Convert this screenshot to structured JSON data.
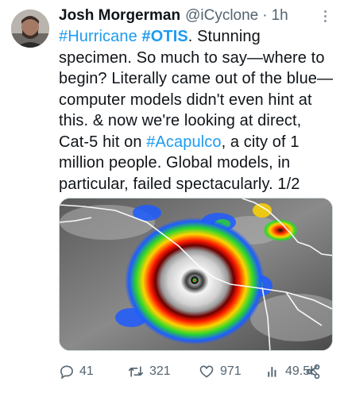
{
  "tweet": {
    "author_name": "Josh Morgerman",
    "handle": "@iCyclone",
    "separator": "·",
    "time": "1h",
    "text_lines": [
      [
        {
          "t": "#Hurricane",
          "c": "link"
        },
        {
          "t": " ",
          "c": "plain"
        },
        {
          "t": "#OTIS",
          "c": "link bold"
        },
        {
          "t": ". Stunning",
          "c": "plain"
        }
      ],
      [
        {
          "t": "specimen. So much to say—where to",
          "c": "plain"
        }
      ],
      [
        {
          "t": "begin? Literally came out of the blue—",
          "c": "plain"
        }
      ],
      [
        {
          "t": "computer models didn't even hint at",
          "c": "plain"
        }
      ],
      [
        {
          "t": "this. & now we're looking at direct,",
          "c": "plain"
        }
      ],
      [
        {
          "t": "Cat-5 hit on ",
          "c": "plain"
        },
        {
          "t": "#Acapulco",
          "c": "link"
        },
        {
          "t": ", a city of 1",
          "c": "plain"
        }
      ],
      [
        {
          "t": "million people. Global models, in",
          "c": "plain"
        }
      ],
      [
        {
          "t": "particular, failed spectacularly. 1/2",
          "c": "plain"
        }
      ]
    ],
    "media_alt": "Infrared satellite image of Hurricane Otis near the Mexican coast",
    "actions": {
      "replies": "41",
      "retweets": "321",
      "likes": "971",
      "views": "49.5K"
    }
  },
  "colors": {
    "link": "#1d9bf0",
    "text": "#0f1419",
    "secondary": "#536471"
  }
}
